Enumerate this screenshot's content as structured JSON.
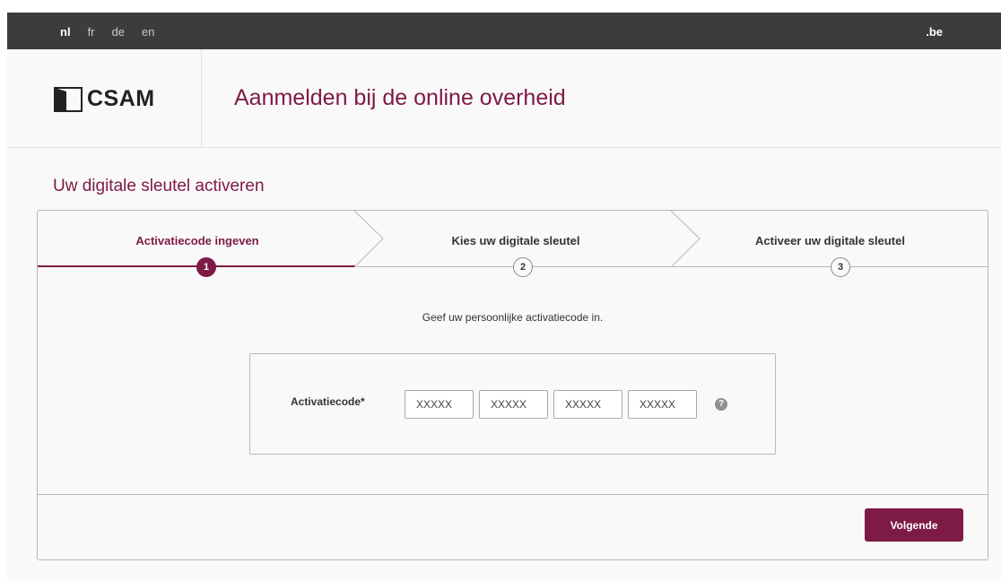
{
  "topbar": {
    "languages": [
      {
        "label": "nl",
        "active": true
      },
      {
        "label": "fr",
        "active": false
      },
      {
        "label": "de",
        "active": false
      },
      {
        "label": "en",
        "active": false
      }
    ],
    "domain": ".be"
  },
  "header": {
    "logo_text": "CSAM",
    "title": "Aanmelden bij de online overheid"
  },
  "section_title": "Uw digitale sleutel activeren",
  "steps": [
    {
      "label": "Activatiecode ingeven",
      "number": "1",
      "active": true
    },
    {
      "label": "Kies uw digitale sleutel",
      "number": "2",
      "active": false
    },
    {
      "label": "Activeer uw digitale sleutel",
      "number": "3",
      "active": false
    }
  ],
  "instruction": "Geef uw persoonlijke activatiecode in.",
  "form": {
    "label": "Activatiecode*",
    "fields": [
      {
        "placeholder": "XXXXX",
        "value": ""
      },
      {
        "placeholder": "XXXXX",
        "value": ""
      },
      {
        "placeholder": "XXXXX",
        "value": ""
      },
      {
        "placeholder": "XXXXX",
        "value": ""
      }
    ],
    "help_icon": "question-circle-icon",
    "help_symbol": "?"
  },
  "next_button": "Volgende",
  "colors": {
    "brand": "#7d1a45",
    "topbar": "#3c3c3c",
    "background": "#f9f9f9",
    "border": "#b7b7b7"
  }
}
